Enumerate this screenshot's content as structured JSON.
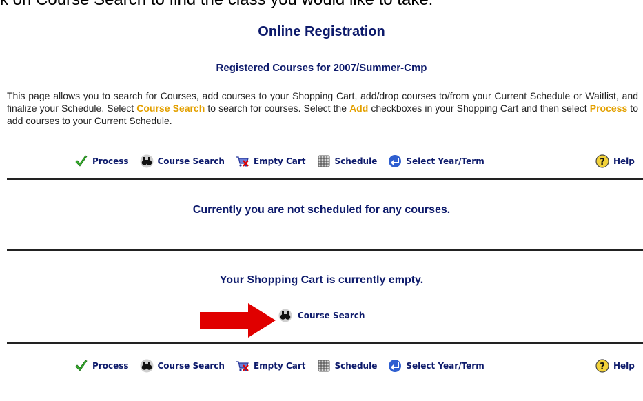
{
  "clipped_heading": "k on Course Search to find the class you would like to take.",
  "page": {
    "title": "Online Registration",
    "subtitle": "Registered Courses for 2007/Summer-Cmp"
  },
  "intro": {
    "part1": "This page allows you to search for Courses, add courses to your Shopping Cart, add/drop courses to/from your Current Schedule or Waitlist, and finalize your Schedule. Select ",
    "course_search": "Course Search",
    "part2": " to search for courses. Select the ",
    "add": "Add",
    "part3": " checkboxes in your Shopping Cart and then select ",
    "process": "Process",
    "part4": " to add courses to your Current Schedule."
  },
  "toolbar": {
    "process": "Process",
    "course_search": "Course Search",
    "empty_cart": "Empty Cart",
    "schedule": "Schedule",
    "select_term": "Select Year/Term",
    "help": "Help"
  },
  "schedule_status": "Currently you are not scheduled for any courses.",
  "cart": {
    "status": "Your Shopping Cart is currently empty.",
    "search_label": "Course Search"
  },
  "colors": {
    "heading_navy": "#0d1a6b",
    "highlight_gold": "#e3a000",
    "arrow_red": "#e00000"
  },
  "icons": [
    "checkmark-icon",
    "binoculars-icon",
    "empty-cart-icon",
    "schedule-icon",
    "select-term-icon",
    "help-icon"
  ]
}
